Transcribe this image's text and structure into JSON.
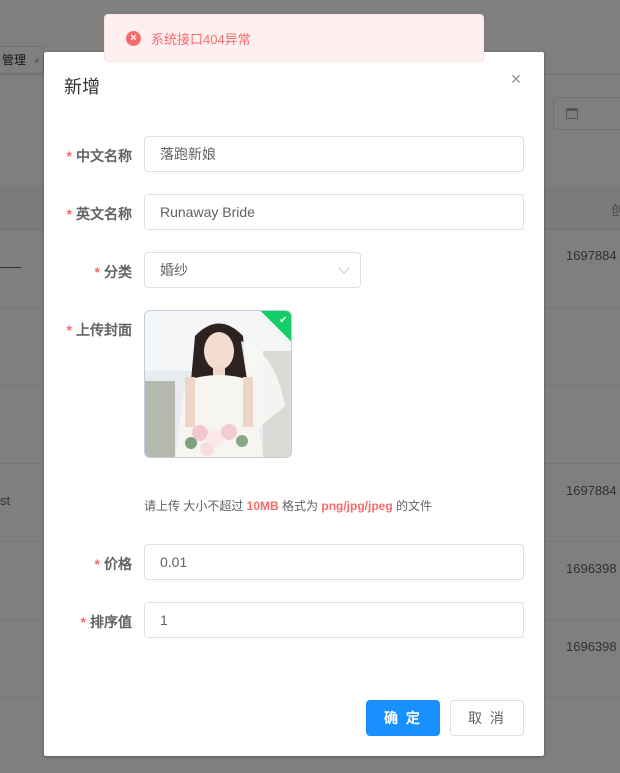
{
  "background": {
    "tab_label": "管理",
    "tab_close": "×",
    "table_header_right": "创",
    "rows": [
      {
        "value": "1697884"
      },
      {
        "value": ""
      },
      {
        "value": ""
      },
      {
        "value": "1697884",
        "left": "st"
      },
      {
        "value": "1696398"
      },
      {
        "value": "1696398"
      }
    ]
  },
  "message": {
    "icon": "close-circle-icon",
    "text": "系统接口404异常",
    "color": "#f56c6c"
  },
  "dialog": {
    "title": "新增",
    "close_icon": "×",
    "fields": {
      "name_cn": {
        "label": "中文名称",
        "value": "落跑新娘"
      },
      "name_en": {
        "label": "英文名称",
        "value": "Runaway Bride"
      },
      "category": {
        "label": "分类",
        "value": "婚纱"
      },
      "cover": {
        "label": "上传封面"
      },
      "price": {
        "label": "价格",
        "value": "0.01"
      },
      "sort": {
        "label": "排序值",
        "value": "1"
      }
    },
    "tip": {
      "prefix": "请上传 大小不超过 ",
      "size": "10MB",
      "middle": " 格式为 ",
      "formats": "png/jpg/jpeg",
      "suffix": " 的文件"
    },
    "buttons": {
      "ok": "确 定",
      "cancel": "取 消"
    }
  },
  "colors": {
    "primary": "#1890ff",
    "danger": "#f56c6c",
    "success": "#13ce66"
  }
}
